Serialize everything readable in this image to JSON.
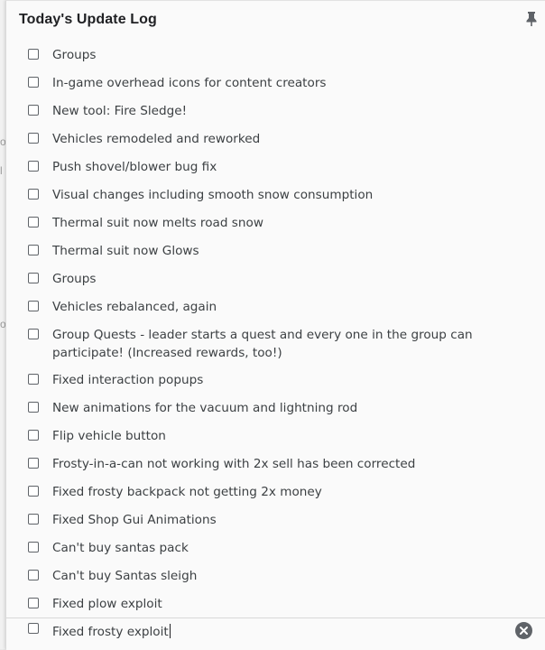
{
  "note": {
    "title": "Today's Update Log",
    "pin_icon": "pin-icon",
    "items": [
      {
        "label": "Groups",
        "checked": false
      },
      {
        "label": "In-game overhead icons for content creators",
        "checked": false
      },
      {
        "label": "New tool: Fire Sledge!",
        "checked": false
      },
      {
        "label": "Vehicles remodeled and reworked",
        "checked": false
      },
      {
        "label": "Push shovel/blower bug fix",
        "checked": false
      },
      {
        "label": "Visual changes including smooth snow consumption",
        "checked": false
      },
      {
        "label": "Thermal suit now melts road snow",
        "checked": false
      },
      {
        "label": "Thermal suit now Glows",
        "checked": false
      },
      {
        "label": "Groups",
        "checked": false
      },
      {
        "label": "Vehicles rebalanced, again",
        "checked": false
      },
      {
        "label": "Group Quests - leader starts a quest and every one in the group can participate! (Increased rewards, too!)",
        "checked": false
      },
      {
        "label": "Fixed interaction popups",
        "checked": false
      },
      {
        "label": "New animations for the vacuum and lightning rod",
        "checked": false
      },
      {
        "label": "Flip vehicle button",
        "checked": false
      },
      {
        "label": "Frosty-in-a-can not working with 2x sell has been corrected",
        "checked": false
      },
      {
        "label": "Fixed frosty backpack not getting 2x money",
        "checked": false
      },
      {
        "label": "Fixed Shop Gui Animations",
        "checked": false
      },
      {
        "label": "Can't buy santas pack",
        "checked": false
      },
      {
        "label": "Can't buy Santas sleigh",
        "checked": false
      },
      {
        "label": "Fixed plow exploit",
        "checked": false
      }
    ],
    "active_item": {
      "label": "Fixed frosty exploit",
      "checked": false
    },
    "clear_icon": "clear-icon"
  },
  "background": {
    "ghost_chars": [
      "o",
      "l",
      "o"
    ]
  }
}
